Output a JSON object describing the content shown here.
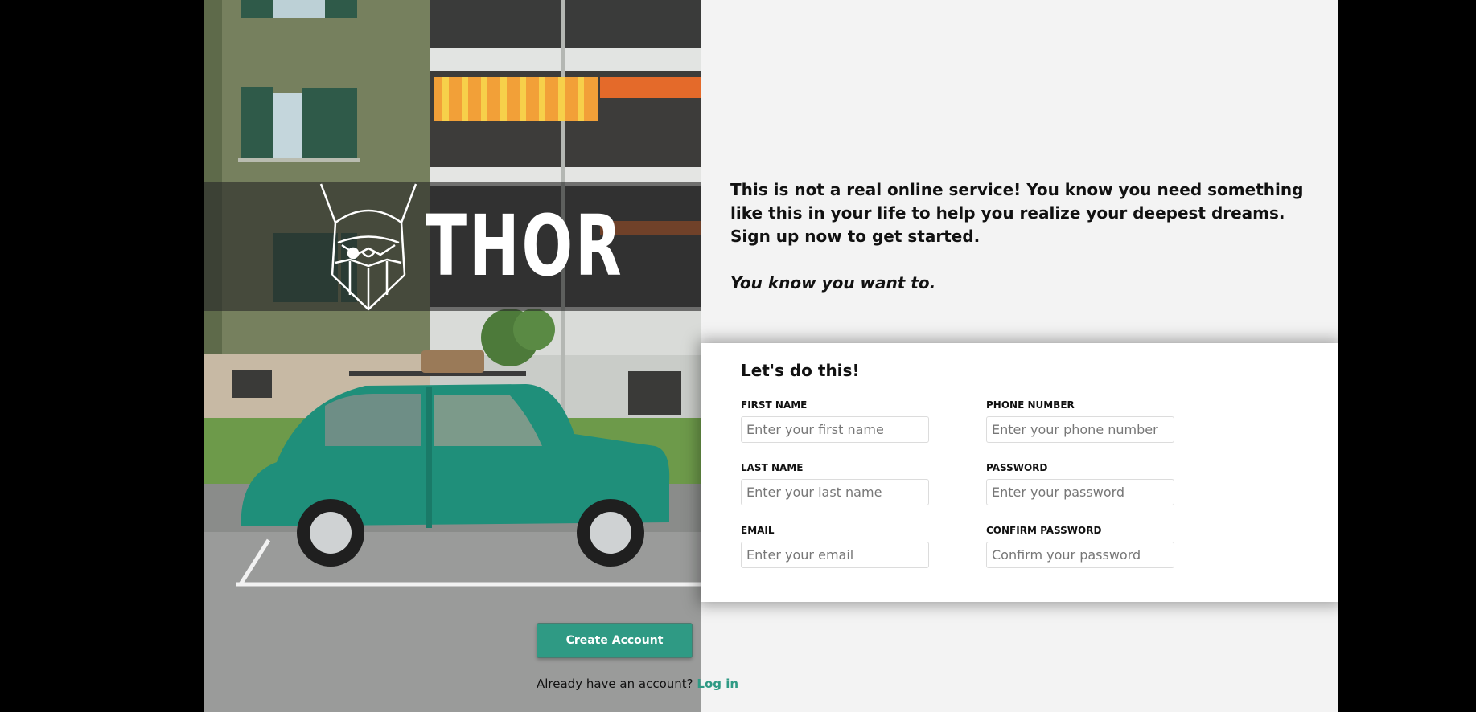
{
  "brand": {
    "name": "THOR",
    "accent_color": "#2f9a84",
    "logo_icon": "viking-helmet-icon"
  },
  "intro": {
    "text": "This is not a real online service! You know you need something like this in your life to help you realize your deepest dreams. Sign up now to get started.",
    "tagline": "You know you want to."
  },
  "form": {
    "title": "Let's do this!",
    "first_name": {
      "label": "FIRST NAME",
      "placeholder": "Enter your first name"
    },
    "last_name": {
      "label": "LAST NAME",
      "placeholder": "Enter your last name"
    },
    "email": {
      "label": "EMAIL",
      "placeholder": "Enter your email"
    },
    "phone": {
      "label": "PHONE NUMBER",
      "placeholder": "Enter your phone number"
    },
    "password": {
      "label": "PASSWORD",
      "placeholder": "Enter your password"
    },
    "confirm_password": {
      "label": "CONFIRM PASSWORD",
      "placeholder": "Confirm your password"
    }
  },
  "actions": {
    "create_account": "Create Account",
    "login_prompt": "Already have an account?",
    "login_link": "Log in"
  }
}
